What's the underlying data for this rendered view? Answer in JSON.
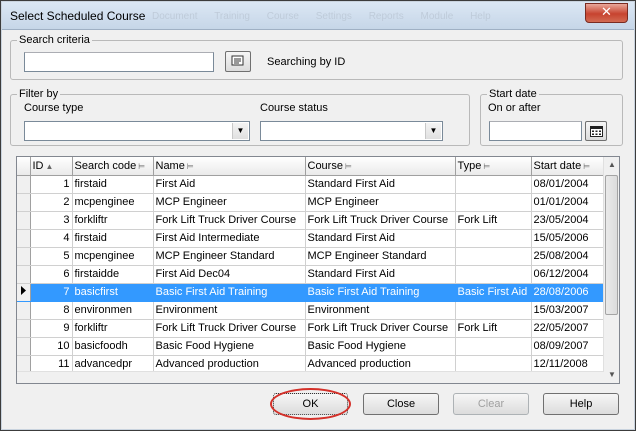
{
  "window": {
    "title": "Select Scheduled Course",
    "close_glyph": "✕",
    "background_menu": [
      "Document",
      "Training",
      "Course",
      "Settings",
      "Reports",
      "Module",
      "Help"
    ]
  },
  "search": {
    "legend": "Search criteria",
    "value": "",
    "mode_label": "Searching by ID"
  },
  "filter": {
    "legend": "Filter by",
    "course_type_label": "Course type",
    "course_type_value": "",
    "course_status_label": "Course status",
    "course_status_value": ""
  },
  "start_date": {
    "legend": "Start date",
    "sub_label": "On or after",
    "value": ""
  },
  "grid": {
    "columns": [
      "ID",
      "Search code",
      "Name",
      "Course",
      "Type",
      "Start date"
    ],
    "rows": [
      {
        "id": "1",
        "code": "firstaid",
        "name": "First Aid",
        "course": "Standard First Aid",
        "type": "",
        "start": "08/01/2004"
      },
      {
        "id": "2",
        "code": "mcpenginee",
        "name": "MCP Engineer",
        "course": "MCP Engineer",
        "type": "",
        "start": "01/01/2004"
      },
      {
        "id": "3",
        "code": "forkliftr",
        "name": "Fork Lift Truck Driver Course",
        "course": "Fork Lift Truck Driver Course",
        "type": "Fork Lift",
        "start": "23/05/2004"
      },
      {
        "id": "4",
        "code": "firstaid",
        "name": "First Aid Intermediate",
        "course": "Standard First Aid",
        "type": "",
        "start": "15/05/2006"
      },
      {
        "id": "5",
        "code": "mcpenginee",
        "name": "MCP Engineer Standard",
        "course": "MCP Engineer Standard",
        "type": "",
        "start": "25/08/2004"
      },
      {
        "id": "6",
        "code": "firstaidde",
        "name": "First Aid Dec04",
        "course": "Standard First Aid",
        "type": "",
        "start": "06/12/2004"
      },
      {
        "id": "7",
        "code": "basicfirst",
        "name": "Basic First Aid Training",
        "course": "Basic First Aid Training",
        "type": "Basic First Aid",
        "start": "28/08/2006",
        "selected": true
      },
      {
        "id": "8",
        "code": "environmen",
        "name": "Environment",
        "course": "Environment",
        "type": "",
        "start": "15/03/2007"
      },
      {
        "id": "9",
        "code": "forkliftr",
        "name": "Fork Lift Truck Driver Course",
        "course": "Fork Lift Truck Driver Course",
        "type": "Fork Lift",
        "start": "22/05/2007"
      },
      {
        "id": "10",
        "code": "basicfoodh",
        "name": "Basic Food Hygiene",
        "course": "Basic Food Hygiene",
        "type": "",
        "start": "08/09/2007"
      },
      {
        "id": "11",
        "code": "advancedpr",
        "name": "Advanced production",
        "course": "Advanced production",
        "type": "",
        "start": "12/11/2008"
      }
    ]
  },
  "buttons": {
    "ok": "OK",
    "close": "Close",
    "clear": "Clear",
    "help": "Help"
  },
  "icons": [
    "lookup-icon",
    "calendar-icon",
    "sort-icon",
    "row-pointer-icon",
    "dropdown-arrow-icon",
    "close-icon"
  ],
  "colors": {
    "selection": "#3399ff",
    "highlight_ring": "#d4312a"
  }
}
